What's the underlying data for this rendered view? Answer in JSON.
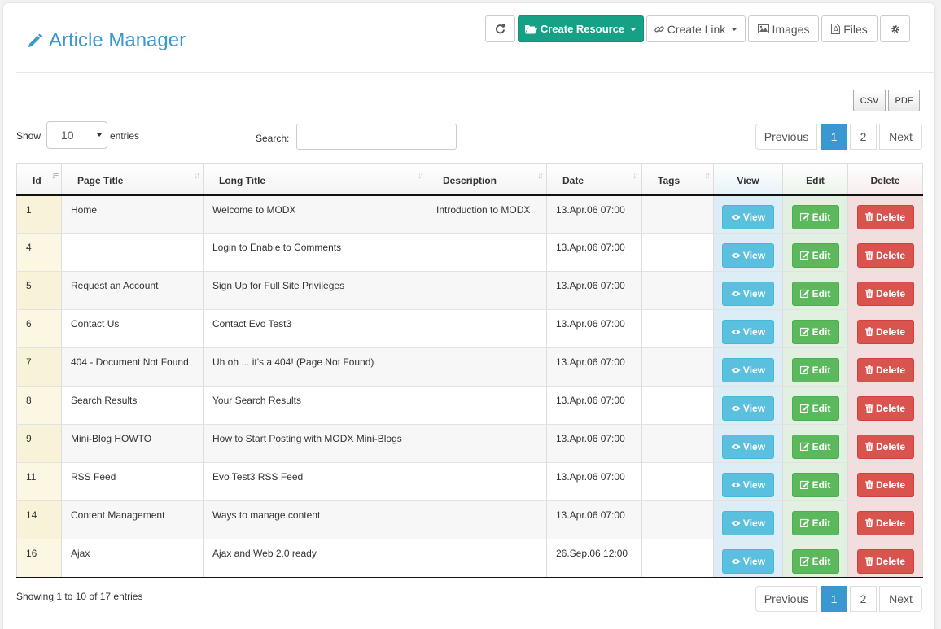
{
  "header": {
    "title": "Article Manager"
  },
  "toolbar": {
    "create_resource": "Create Resource",
    "create_link": "Create Link",
    "images": "Images",
    "files": "Files"
  },
  "export": {
    "csv": "CSV",
    "pdf": "PDF"
  },
  "length": {
    "show": "Show",
    "value": "10",
    "entries": "entries"
  },
  "search": {
    "label": "Search:",
    "value": ""
  },
  "pagination": {
    "previous": "Previous",
    "page1": "1",
    "page2": "2",
    "next": "Next"
  },
  "table": {
    "columns": [
      "Id",
      "Page Title",
      "Long Title",
      "Description",
      "Date",
      "Tags",
      "View",
      "Edit",
      "Delete"
    ],
    "rows": [
      {
        "id": "1",
        "page_title": "Home",
        "long_title": "Welcome to MODX",
        "description": "Introduction to MODX",
        "date": "13.Apr.06 07:00",
        "tags": ""
      },
      {
        "id": "4",
        "page_title": "",
        "long_title": "Login to Enable to Comments",
        "description": "",
        "date": "13.Apr.06 07:00",
        "tags": ""
      },
      {
        "id": "5",
        "page_title": "Request an Account",
        "long_title": "Sign Up for Full Site Privileges",
        "description": "",
        "date": "13.Apr.06 07:00",
        "tags": ""
      },
      {
        "id": "6",
        "page_title": "Contact Us",
        "long_title": "Contact Evo Test3",
        "description": "",
        "date": "13.Apr.06 07:00",
        "tags": ""
      },
      {
        "id": "7",
        "page_title": "404 - Document Not Found",
        "long_title": "Uh oh ... it's a 404! (Page Not Found)",
        "description": "",
        "date": "13.Apr.06 07:00",
        "tags": ""
      },
      {
        "id": "8",
        "page_title": "Search Results",
        "long_title": "Your Search Results",
        "description": "",
        "date": "13.Apr.06 07:00",
        "tags": ""
      },
      {
        "id": "9",
        "page_title": "Mini-Blog HOWTO",
        "long_title": "How to Start Posting with MODX Mini-Blogs",
        "description": "",
        "date": "13.Apr.06 07:00",
        "tags": ""
      },
      {
        "id": "11",
        "page_title": "RSS Feed",
        "long_title": "Evo Test3 RSS Feed",
        "description": "",
        "date": "13.Apr.06 07:00",
        "tags": ""
      },
      {
        "id": "14",
        "page_title": "Content Management",
        "long_title": "Ways to manage content",
        "description": "",
        "date": "13.Apr.06 07:00",
        "tags": ""
      },
      {
        "id": "16",
        "page_title": "Ajax",
        "long_title": "Ajax and Web 2.0 ready",
        "description": "",
        "date": "26.Sep.06 12:00",
        "tags": ""
      }
    ],
    "actions": {
      "view": "View",
      "edit": "Edit",
      "delete": "Delete"
    }
  },
  "info": "Showing 1 to 10 of 17 entries",
  "colors": {
    "accent": "#3a97d0",
    "primary": "#16a086",
    "view": "#5bc0de",
    "edit": "#5cb85c",
    "delete": "#d9534f"
  }
}
